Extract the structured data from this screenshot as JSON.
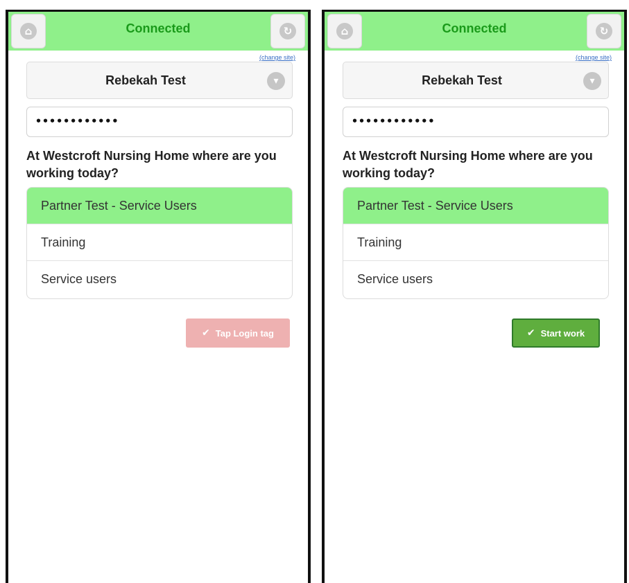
{
  "screens": [
    {
      "header_title": "Connected",
      "change_site": "(change site)",
      "site_name": "Rebekah Test",
      "password_value": "••••••••••••",
      "question": "At Westcroft Nursing Home where are you working today?",
      "options": [
        "Partner Test - Service Users",
        "Training",
        "Service users"
      ],
      "selected_option": "Partner Test - Service Users",
      "button_label": "Tap Login tag"
    },
    {
      "header_title": "Connected",
      "change_site": "(change site)",
      "site_name": "Rebekah Test",
      "password_value": "••••••••••••",
      "question": "At Westcroft Nursing Home where are you working today?",
      "options": [
        "Partner Test - Service Users",
        "Training",
        "Service users"
      ],
      "selected_option": "Partner Test - Service Users",
      "button_label": "Start work"
    }
  ],
  "icons": {
    "home": "home-icon",
    "refresh": "refresh-icon",
    "chevron": "chevron-down-icon",
    "check": "checkmark-icon"
  },
  "colors": {
    "header_green": "#8ff08a",
    "title_green": "#1a9a1a",
    "disabled_button": "#eeb1b1",
    "start_button": "#5fae3e"
  }
}
